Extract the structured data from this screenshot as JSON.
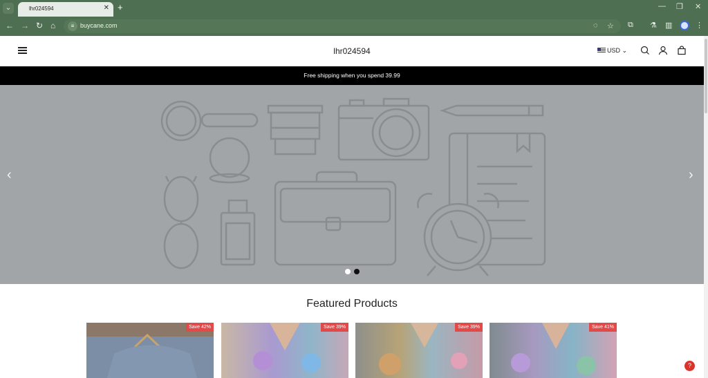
{
  "browser": {
    "tab_title": "lhr024594",
    "url": "buycane.com",
    "icons": {
      "tab_menu": "chevron-down-icon",
      "new_tab": "plus-icon",
      "minimize": "minimize-icon",
      "restore": "restore-icon",
      "close": "close-icon"
    }
  },
  "header": {
    "store_name": "lhr024594",
    "currency": "USD"
  },
  "announcement": "Free shipping when you spend 39.99",
  "hero": {
    "slide_count": 2,
    "active_slide": 2
  },
  "featured": {
    "title": "Featured Products",
    "products": [
      {
        "badge": "Save 42%",
        "colors": [
          "#8a7a6a",
          "#7f93ad"
        ]
      },
      {
        "badge": "Save 39%",
        "colors": [
          "#b7a99a",
          "#9a92c9"
        ]
      },
      {
        "badge": "Save 39%",
        "colors": [
          "#8d8f8c",
          "#a29a86"
        ]
      },
      {
        "badge": "Save 41%",
        "colors": [
          "#7f8b8e",
          "#9f97b8"
        ]
      }
    ]
  },
  "colors": {
    "chrome": "#4f6f52",
    "announcement_bg": "#000000",
    "hero_bg": "#a1a5a8",
    "badge": "#e24a4a"
  }
}
